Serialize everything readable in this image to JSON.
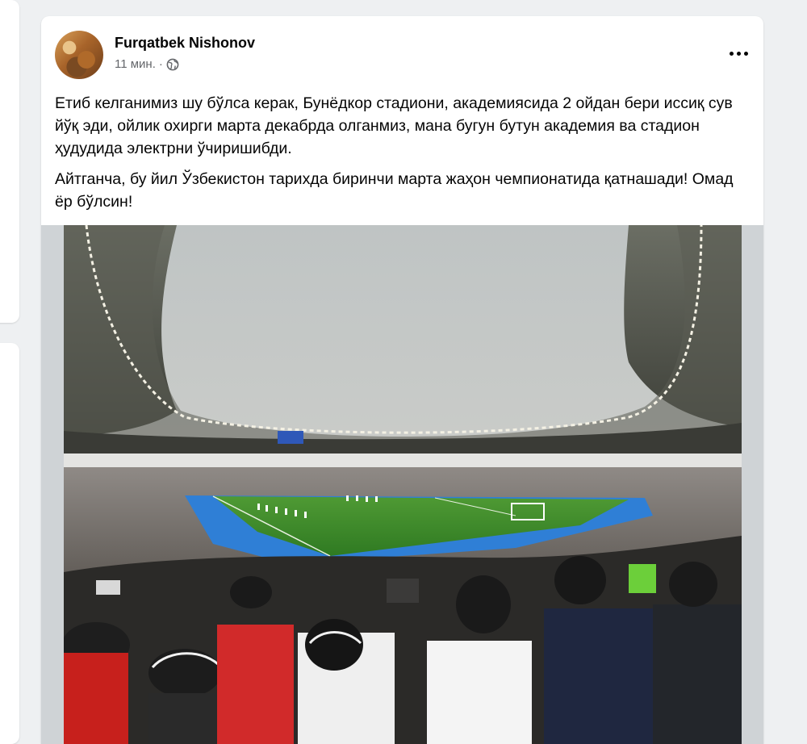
{
  "post": {
    "author": "Furqatbek Nishonov",
    "time": "11 мин.",
    "separator": "·",
    "privacy_icon": "globe-icon",
    "more_icon": "more-horizontal-icon",
    "paragraphs": [
      "Етиб келганимиз шу бўлса керак, Бунёдкор стадиони, академиясида 2 ойдан бери иссиқ сув йўқ эди, ойлик охирги марта декабрда олганмиз, мана бугун бутун академия ва стадион ҳудудида электрни ўчиришибди.",
      "Айтганча, бу йил Ўзбекистон тарихда биринчи марта жаҳон чемпионатида қатнашади! Омад ёр бўлсин!"
    ],
    "image": {
      "subject": "stadium-photo"
    }
  },
  "colors": {
    "page_bg": "#eef0f2",
    "card_bg": "#ffffff",
    "secondary_text": "#65676b",
    "pitch": "#3f8a2c",
    "track": "#2f7fd6"
  }
}
